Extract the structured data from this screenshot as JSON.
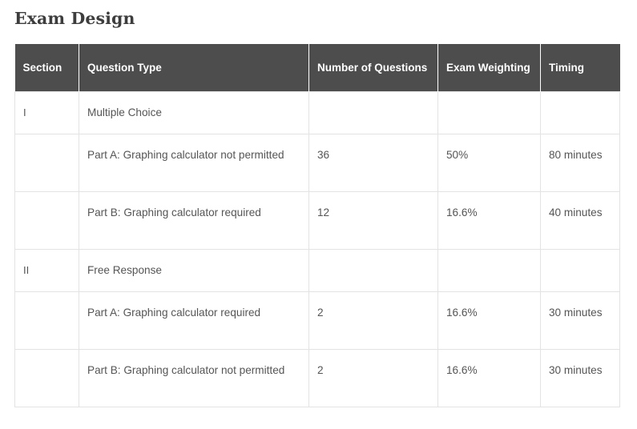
{
  "page": {
    "title": "Exam Design",
    "background_color": "#ffffff"
  },
  "table": {
    "header_background": "#4d4d4d",
    "header_text_color": "#ffffff",
    "border_color": "#e3e3e3",
    "body_text_color": "#555555",
    "columns": [
      {
        "key": "section",
        "label": "Section"
      },
      {
        "key": "question_type",
        "label": "Question Type"
      },
      {
        "key": "number_of_questions",
        "label": "Number of Questions"
      },
      {
        "key": "exam_weighting",
        "label": "Exam Weighting"
      },
      {
        "key": "timing",
        "label": "Timing"
      }
    ],
    "rows": [
      {
        "section": "I",
        "question_type": "Multiple Choice",
        "number_of_questions": "",
        "exam_weighting": "",
        "timing": ""
      },
      {
        "section": "",
        "question_type": "Part A: Graphing calculator not permitted",
        "number_of_questions": "36",
        "exam_weighting": "50%",
        "timing": "80 minutes"
      },
      {
        "section": "",
        "question_type": "Part B: Graphing calculator required",
        "number_of_questions": "12",
        "exam_weighting": "16.6%",
        "timing": "40 minutes"
      },
      {
        "section": "II",
        "question_type": "Free Response",
        "number_of_questions": "",
        "exam_weighting": "",
        "timing": ""
      },
      {
        "section": "",
        "question_type": "Part A: Graphing calculator required",
        "number_of_questions": "2",
        "exam_weighting": "16.6%",
        "timing": "30 minutes"
      },
      {
        "section": "",
        "question_type": "Part B: Graphing calculator not permitted",
        "number_of_questions": "2",
        "exam_weighting": "16.6%",
        "timing": "30 minutes"
      }
    ]
  }
}
